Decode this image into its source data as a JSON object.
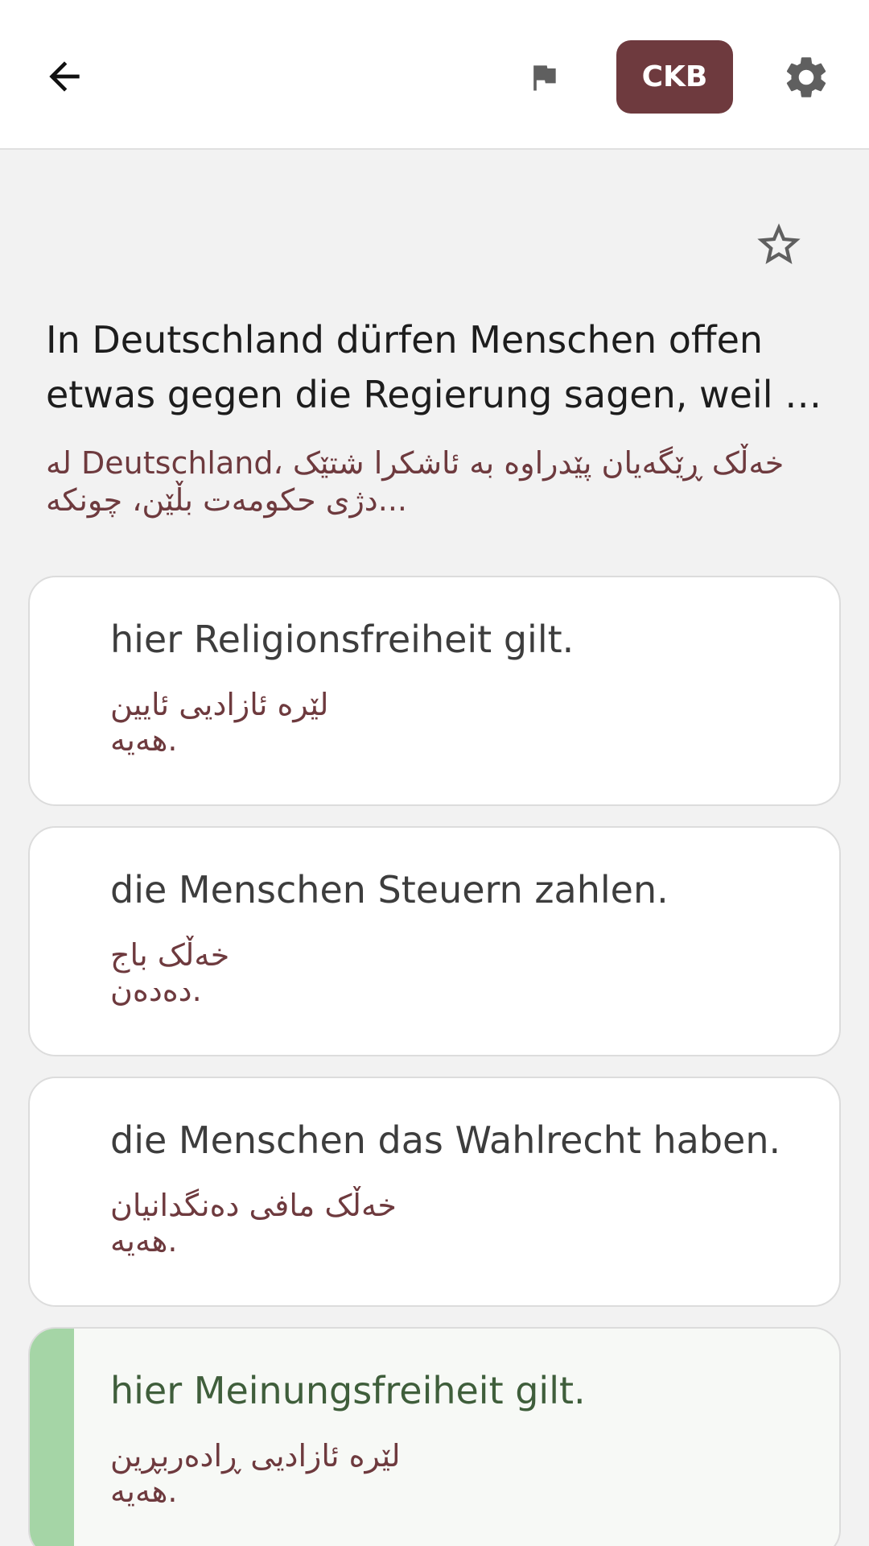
{
  "header": {
    "language_button": "CKB",
    "icons": [
      "arrow-left-icon",
      "flag-icon",
      "gear-icon"
    ]
  },
  "question": {
    "text": "In Deutschland dürfen Menschen offen\netwas gegen die Regierung sagen, weil …",
    "translation": "له Deutschland، خەڵک ڕێگەیان پێدراوە بە ئاشکرا شتێک\nدژی حکومەت بڵێن، چونکە...",
    "favorite_icon": "star-outline-icon"
  },
  "answers": [
    {
      "text": "hier Religionsfreiheit gilt.",
      "translation": "لێرە ئازادیی ئایین\nهەیە.",
      "correct": false
    },
    {
      "text": "die Menschen Steuern zahlen.",
      "translation": "خەڵک باج\nدەدەن.",
      "correct": false
    },
    {
      "text": "die Menschen das Wahlrecht haben.",
      "translation": "خەڵک مافی دەنگدانیان\nهەیە.",
      "correct": false
    },
    {
      "text": "hier Meinungsfreiheit gilt.",
      "translation": "لێرە ئازادیی ڕادەربڕین\nهەیە.",
      "correct": true
    }
  ],
  "colors": {
    "accent": "#6e3a3e",
    "correct_bar": "#a5d5a6",
    "correct_text": "#3f5e3b"
  }
}
